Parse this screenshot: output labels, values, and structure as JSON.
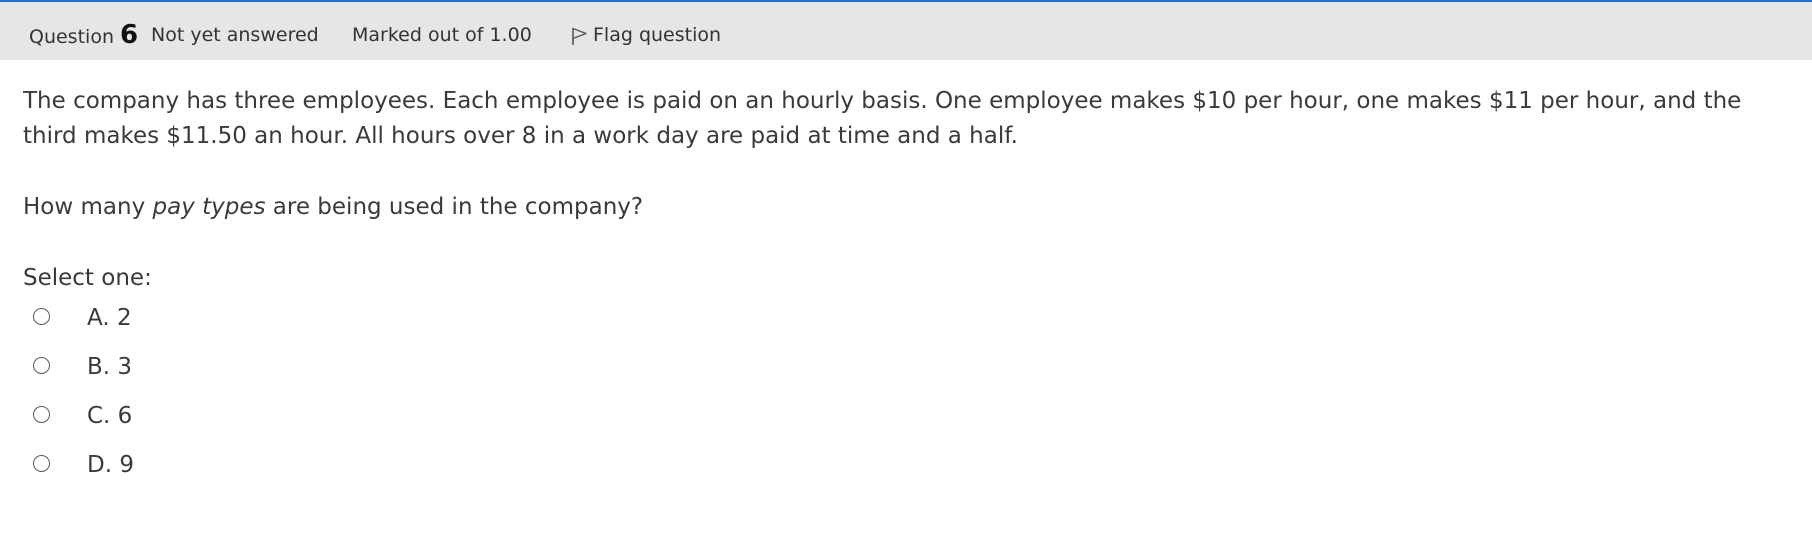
{
  "header": {
    "question_label": "Question",
    "question_number": "6",
    "state": "Not yet answered",
    "grade": "Marked out of 1.00",
    "flag_label": "Flag question"
  },
  "question": {
    "text": "The company has three employees. Each employee is paid on an hourly basis. One employee makes $10 per hour, one makes $11 per hour, and the third makes $11.50 an hour. All hours over 8 in a work day are paid at time and a half.",
    "prompt_before": "How many ",
    "prompt_emphasis": "pay types",
    "prompt_after": " are being used in the company?"
  },
  "answer": {
    "instruction": "Select one:",
    "options": [
      {
        "label": "A. 2",
        "selected": false
      },
      {
        "label": "B. 3",
        "selected": false
      },
      {
        "label": "C. 6",
        "selected": false
      },
      {
        "label": "D. 9",
        "selected": false
      }
    ]
  },
  "colors": {
    "accent": "#1f6fd6",
    "header_bg": "#e6e6e6",
    "text": "#3a3a3a"
  }
}
